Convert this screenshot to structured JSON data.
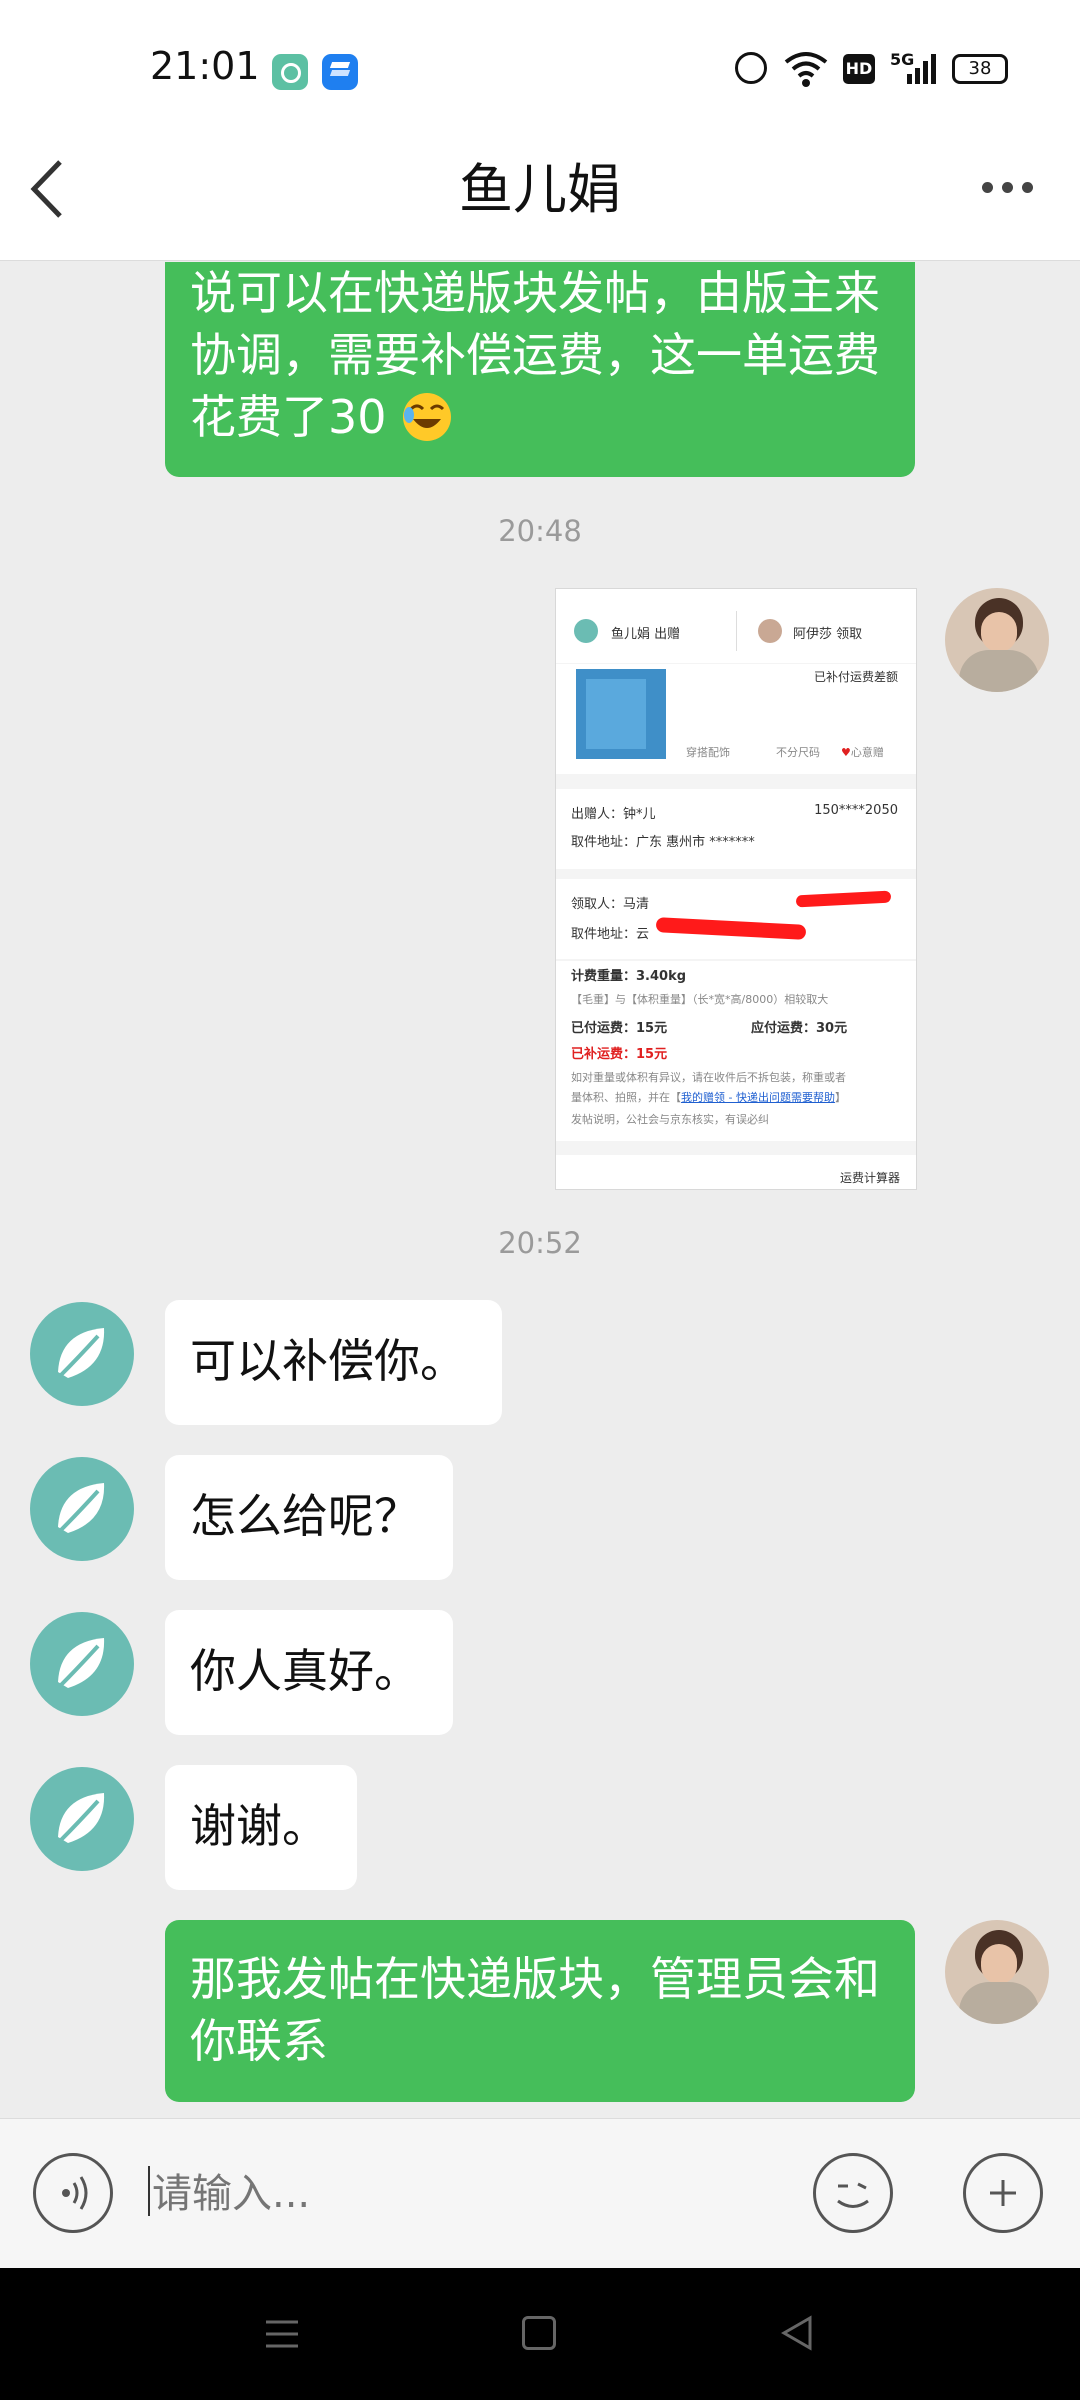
{
  "status_bar": {
    "time": "21:01",
    "network": "5G",
    "hd": "HD",
    "battery": "38"
  },
  "header": {
    "title": "鱼儿娟",
    "back_icon": "chevron-left-icon",
    "more_icon": "more-horizontal-icon"
  },
  "messages": {
    "m1": "说可以在快递版块发帖，由版主来协调，需要补偿运费，这一单运费花费了30",
    "ts1": "20:48",
    "ts2": "20:52",
    "m3": "可以补偿你。",
    "m4": "怎么给呢？",
    "m5": "你人真好。",
    "m6": "谢谢。",
    "m7": "那我发帖在快递版块，管理员会和你联系"
  },
  "card": {
    "giver_tab": "鱼儿娟 出赠",
    "receiver_tab": "阿伊莎 领取",
    "paid_status": "已补付运费差额",
    "category": "穿搭配饰",
    "size": "不分尺码",
    "heart": "心意赠",
    "giver_label": "出赠人：钟*儿",
    "giver_phone": "150****2050",
    "pickup_addr": "取件地址：广东 惠州市 *******",
    "receiver_label": "领取人：马清",
    "receiver_addr": "取件地址：云",
    "weight": "计费重量：3.40kg",
    "weight_note": "【毛重】与【体积重量】（长*宽*高/8000）相较取大",
    "paid": "已付运费：15元",
    "due": "应付运费：30元",
    "topped": "已补运费：15元",
    "note_line1": "如对重量或体积有异议，请在收件后不拆包装，称重或者",
    "note_line2": "量体积、拍照，并在【",
    "note_link": "我的赠领 - 快递出问题需要帮助",
    "note_line3": "发帖说明，公社会与京东核实，有误必纠",
    "calc_link": "运费计算器"
  },
  "input": {
    "placeholder": "请输入..."
  },
  "colors": {
    "green_bubble": "#45be5a",
    "background": "#ededed",
    "avatar_teal": "#6bbcb3",
    "accent_red": "#e02020"
  }
}
